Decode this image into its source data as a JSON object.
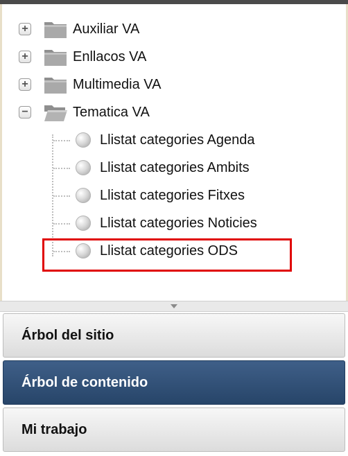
{
  "tree": {
    "folders": [
      {
        "label": "Auxiliar VA",
        "state": "collapsed",
        "toggle": "+"
      },
      {
        "label": "Enllacos VA",
        "state": "collapsed",
        "toggle": "+"
      },
      {
        "label": "Multimedia VA",
        "state": "collapsed",
        "toggle": "+"
      },
      {
        "label": "Tematica VA",
        "state": "expanded",
        "toggle": "−"
      }
    ],
    "children": [
      {
        "label": "Llistat categories Agenda"
      },
      {
        "label": "Llistat categories Ambits"
      },
      {
        "label": "Llistat categories Fitxes"
      },
      {
        "label": "Llistat categories Noticies"
      },
      {
        "label": "Llistat categories ODS",
        "highlighted": true
      }
    ]
  },
  "accordion": {
    "site_tree": "Árbol del sitio",
    "content_tree": "Árbol de contenido",
    "my_work": "Mi trabajo",
    "active": "content_tree"
  },
  "colors": {
    "highlight_border": "#e00000",
    "active_tab": "#2f4e75"
  },
  "icons": {
    "folder_closed": "folder-icon",
    "folder_open": "folder-open-icon",
    "leaf": "bullet-icon"
  }
}
